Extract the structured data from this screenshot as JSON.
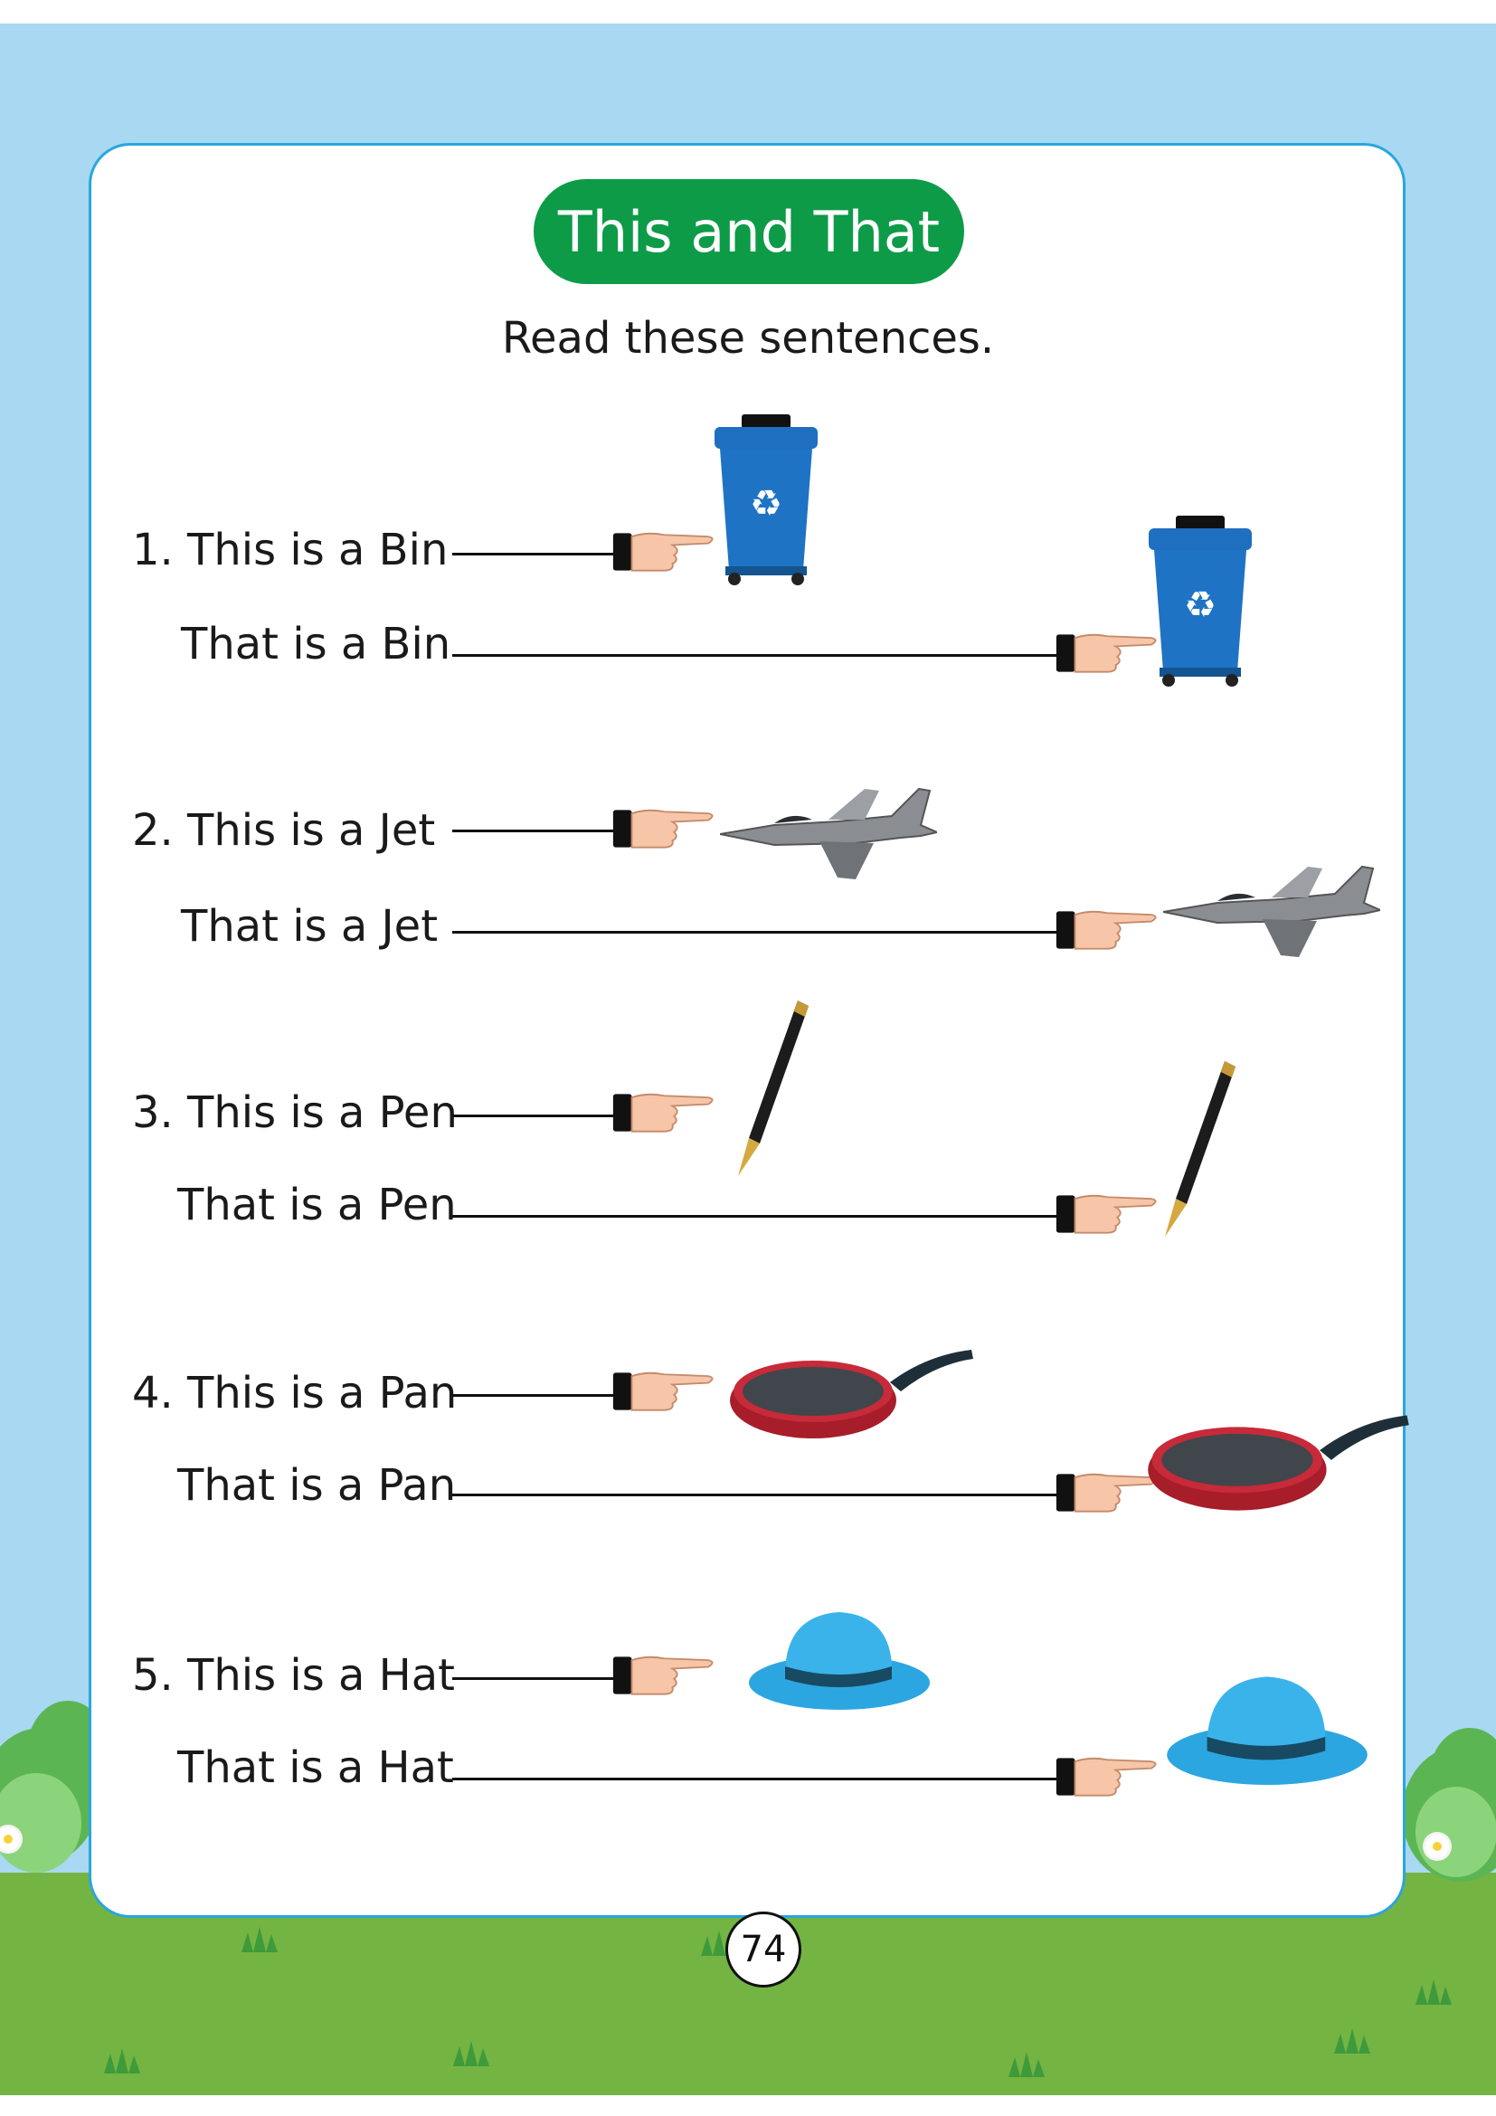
{
  "page": {
    "title": "This and That",
    "instruction": "Read these sentences.",
    "page_number": "74"
  },
  "sentences": [
    {
      "this": "1.  This is a Bin",
      "that": "That is a Bin",
      "object_icon": "recycle-bin-icon"
    },
    {
      "this": "2. This is a Jet",
      "that": "That is a Jet",
      "object_icon": "fighter-jet-icon"
    },
    {
      "this": "3. This is a Pen",
      "that": "That is a Pen",
      "object_icon": "fountain-pen-icon"
    },
    {
      "this": "4. This is a Pan",
      "that": "That is a Pan",
      "object_icon": "frying-pan-icon"
    },
    {
      "this": "5. This is a Hat",
      "that": "That is a Hat",
      "object_icon": "hat-icon"
    }
  ],
  "colors": {
    "sky": "#a8d8f2",
    "ground": "#74b443",
    "title_pill": "#0d9b48",
    "card_border": "#29a6de"
  }
}
